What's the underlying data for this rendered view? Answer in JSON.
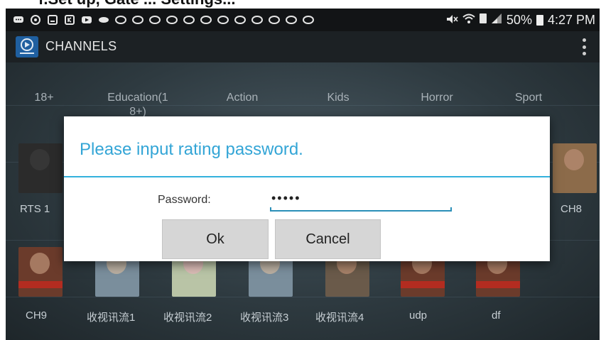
{
  "caption": "f.Set up, Gate ... Settings...",
  "status": {
    "battery": "50%",
    "time": "4:27 PM"
  },
  "app": {
    "title": "CHANNELS"
  },
  "categories": [
    "18+",
    "Education(1\n8+)",
    "Action",
    "Kids",
    "Horror",
    "Sport"
  ],
  "channels_row1": [
    {
      "label": "RTS 1"
    },
    {
      "label": "CH8"
    }
  ],
  "channels_row2": [
    {
      "label": "CH9"
    },
    {
      "label": "收视讯流1"
    },
    {
      "label": "收视讯流2"
    },
    {
      "label": "收视讯流3"
    },
    {
      "label": "收视讯流4"
    },
    {
      "label": "udp"
    },
    {
      "label": "df"
    }
  ],
  "dialog": {
    "title": "Please input rating password.",
    "password_label": "Password:",
    "password_value": "•••••",
    "ok_label": "Ok",
    "cancel_label": "Cancel"
  }
}
